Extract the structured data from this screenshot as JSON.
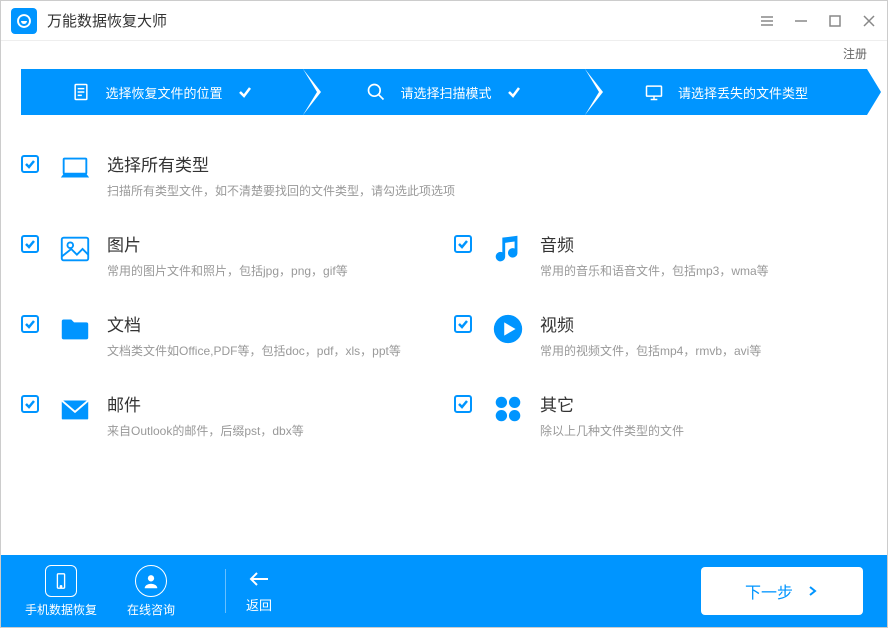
{
  "app": {
    "title": "万能数据恢复大师"
  },
  "subbar": {
    "register": "注册"
  },
  "steps": {
    "s1": "选择恢复文件的位置",
    "s2": "请选择扫描模式",
    "s3": "请选择丢失的文件类型"
  },
  "types": {
    "all": {
      "title": "选择所有类型",
      "desc": "扫描所有类型文件，如不清楚要找回的文件类型，请勾选此项选项"
    },
    "image": {
      "title": "图片",
      "desc": "常用的图片文件和照片，包括jpg，png，gif等"
    },
    "audio": {
      "title": "音频",
      "desc": "常用的音乐和语音文件，包括mp3，wma等"
    },
    "doc": {
      "title": "文档",
      "desc": "文档类文件如Office,PDF等，包括doc，pdf，xls，ppt等"
    },
    "video": {
      "title": "视频",
      "desc": "常用的视频文件，包括mp4，rmvb，avi等"
    },
    "mail": {
      "title": "邮件",
      "desc": "来自Outlook的邮件，后缀pst，dbx等"
    },
    "other": {
      "title": "其它",
      "desc": "除以上几种文件类型的文件"
    }
  },
  "footer": {
    "phone": "手机数据恢复",
    "consult": "在线咨询",
    "back": "返回",
    "next": "下一步"
  }
}
